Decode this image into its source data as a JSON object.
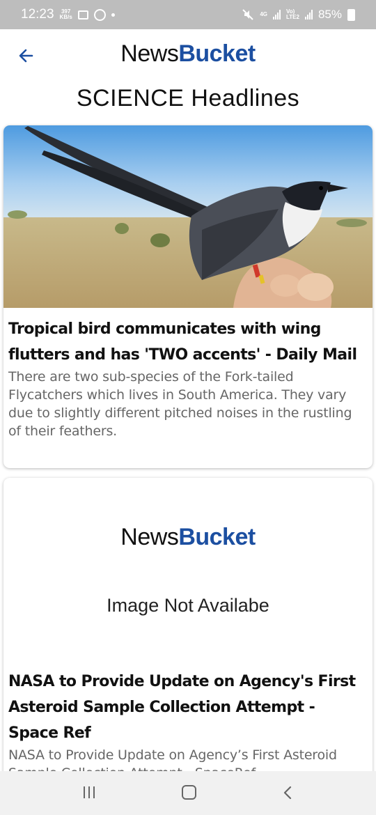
{
  "status_bar": {
    "time": "12:23",
    "net_speed_value": "397",
    "net_speed_unit": "KB/s",
    "network_4g": "4G",
    "volte": "Vo)",
    "lte2": "LTE2",
    "battery": "85%",
    "icons": [
      "gallery-icon",
      "whatsapp-icon",
      "dot-icon",
      "mute-icon",
      "signal-icon",
      "battery-charging-icon"
    ]
  },
  "header": {
    "brand_part1": "News",
    "brand_part2": "Bucket",
    "back_icon": "arrow-back-icon"
  },
  "section_title": "SCIENCE Headlines",
  "articles": [
    {
      "headline": "Tropical bird communicates with wing flutters and has 'TWO accents' - Daily Mail",
      "description": "There are two sub-species of the Fork-tailed Flycatchers which lives in South America. They vary due to slightly different pitched noises in the rustling of their feathers."
    },
    {
      "placeholder_brand_part1": "News",
      "placeholder_brand_part2": "Bucket",
      "placeholder_text": "Image Not Availabe",
      "headline": "NASA to Provide Update on Agency's First Asteroid Sample Collection Attempt - Space Ref",
      "description": "NASA to Provide Update on Agency’s First Asteroid Sample Collection Attempt - SpaceRef"
    }
  ],
  "colors": {
    "brand_blue": "#1c4fa1",
    "status_bar": "#bdbdbd",
    "nav_bar": "#f1f1f1"
  },
  "nav_bar": {
    "icons": [
      "recents-icon",
      "home-icon",
      "back-icon"
    ]
  }
}
